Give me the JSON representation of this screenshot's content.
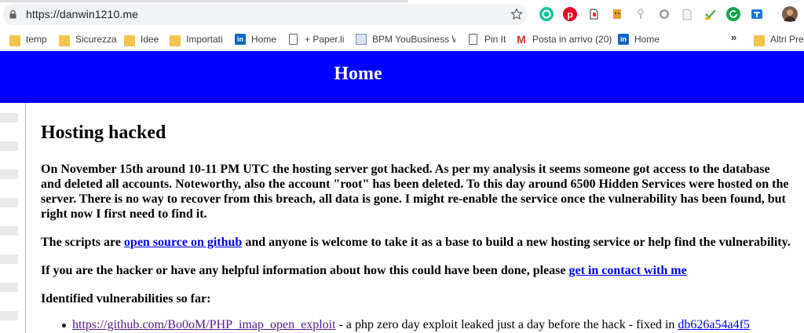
{
  "browser": {
    "url": "https://danwin1210.me",
    "overflow_label": "»",
    "extensions": [
      {
        "name": "grammarly-icon",
        "color": "#15c39a"
      },
      {
        "name": "pinterest-icon",
        "color": "#e60023"
      },
      {
        "name": "evernote-icon",
        "color": "#5a5a5a"
      },
      {
        "name": "honey-icon",
        "color": "#e89b2f"
      },
      {
        "name": "pen-icon",
        "color": "#bdbdbd"
      },
      {
        "name": "circle-extension-icon",
        "color": "#9e9e9e"
      },
      {
        "name": "pdf-icon",
        "color": "#c7c7c7"
      },
      {
        "name": "checkmark-extension-icon",
        "color": "#4caf50"
      },
      {
        "name": "refresh-extension-icon",
        "color": "#15a34a"
      },
      {
        "name": "translate-extension-icon",
        "color": "#1a73e8"
      },
      {
        "name": "profile-avatar-icon",
        "color": "#7b5e49"
      }
    ]
  },
  "bookmarks": [
    {
      "label": "temp",
      "icon": "folder-icon"
    },
    {
      "label": "Sicurezza",
      "icon": "folder-icon"
    },
    {
      "label": "Idee",
      "icon": "folder-icon"
    },
    {
      "label": "Importati",
      "icon": "folder-icon"
    },
    {
      "label": "Home",
      "icon": "linkedin-icon"
    },
    {
      "label": "+ Paper.li",
      "icon": "page-icon"
    },
    {
      "label": "BPM YouBusiness We",
      "icon": "bpm-icon"
    },
    {
      "label": "Pin It",
      "icon": "page-icon"
    },
    {
      "label": "Posta in arrivo (20)",
      "icon": "gmail-icon"
    },
    {
      "label": "Home",
      "icon": "linkedin-icon"
    },
    {
      "label": "Altri Pref",
      "icon": "folder-icon"
    }
  ],
  "page": {
    "header_title": "Home",
    "heading": "Hosting hacked",
    "intro_lines": [
      "On November 15th around 10-11 PM UTC the hosting server got hacked. As per my analysis it seems someone got access to the database",
      "and deleted all accounts. Noteworthy, also the account \"root\" has been deleted. To this day around 6500 Hidden Services were hosted on the",
      "server. There is no way to recover from this breach, all data is gone. I might re-enable the service once the vulnerability has been found, but",
      "right now I first need to find it."
    ],
    "scripts_pre": "The scripts are ",
    "scripts_link": "open source on github",
    "scripts_post": " and anyone is welcome to take it as a base to build a new hosting service or help find the vulnerability.",
    "contact_pre": "If you are the hacker or have any helpful information about how this could have been done, please ",
    "contact_link": "get in contact with me",
    "vuln_heading": "Identified vulnerabilities so far:",
    "vulns": [
      {
        "link": "https://github.com/Bo0oM/PHP_imap_open_exploit",
        "text": " - a php zero day exploit leaked just a day before the hack - fixed in ",
        "fix_link": "db626a54a4f5"
      }
    ]
  }
}
